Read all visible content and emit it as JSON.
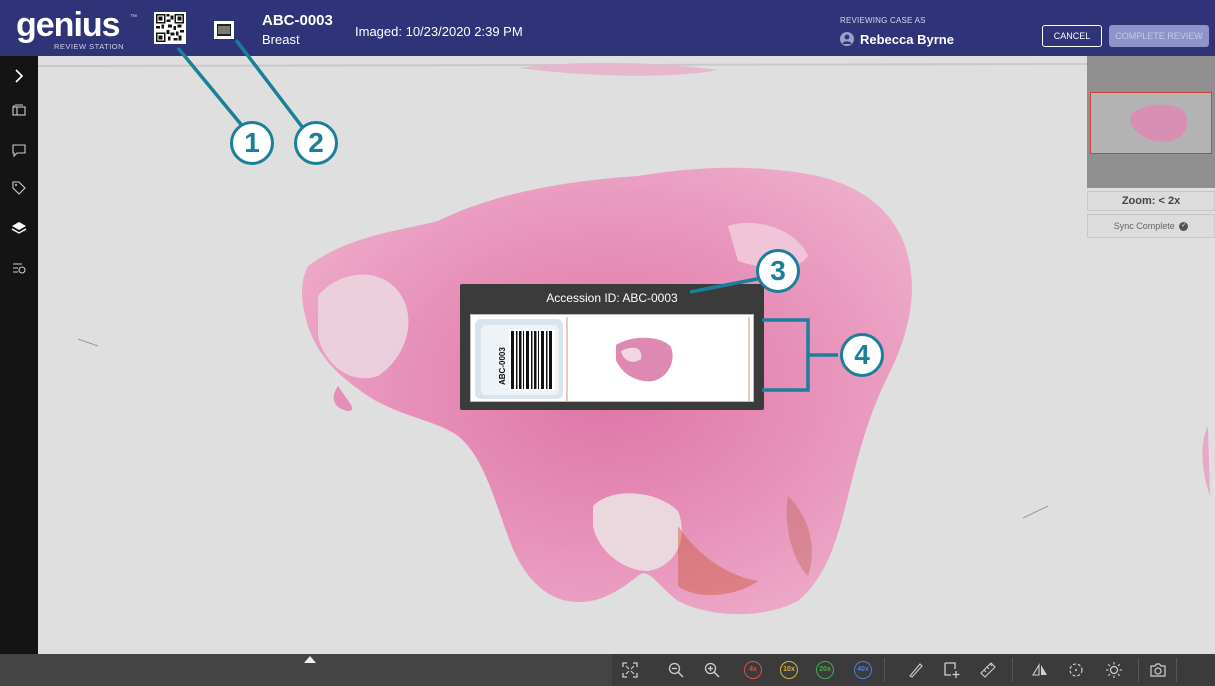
{
  "header": {
    "logo_text": "genius",
    "logo_tm": "™",
    "logo_subtitle": "REVIEW STATION",
    "case_id": "ABC-0003",
    "case_type": "Breast",
    "imaged": "Imaged: 10/23/2020 2:39 PM",
    "reviewing_label": "REVIEWING CASE AS",
    "reviewer_name": "Rebecca Byrne",
    "cancel_label": "CANCEL",
    "complete_label": "COMPLETE REVIEW"
  },
  "sidebar": {
    "items": [
      {
        "icon": "chevron-right-icon"
      },
      {
        "icon": "slides-stack-icon"
      },
      {
        "icon": "comment-icon"
      },
      {
        "icon": "tag-icon"
      },
      {
        "icon": "layers-icon"
      },
      {
        "icon": "filter-list-icon"
      }
    ]
  },
  "mini_panel": {
    "zoom": "Zoom: < 2x",
    "sync": "Sync Complete"
  },
  "popup": {
    "title": "Accession ID: ABC-0003",
    "label_text": "ABC-0003"
  },
  "callouts": [
    "1",
    "2",
    "3",
    "4"
  ],
  "toolbar": {
    "zoom_levels": [
      {
        "label": "4x",
        "color": "#e24a4a"
      },
      {
        "label": "10x",
        "color": "#d4b43a"
      },
      {
        "label": "20x",
        "color": "#3fae4a"
      },
      {
        "label": "40x",
        "color": "#4a7de0"
      }
    ]
  },
  "colors": {
    "header_bg": "#2f3377",
    "accent_callout": "#1b7f9a",
    "tissue_pink": "#e58fb7"
  }
}
